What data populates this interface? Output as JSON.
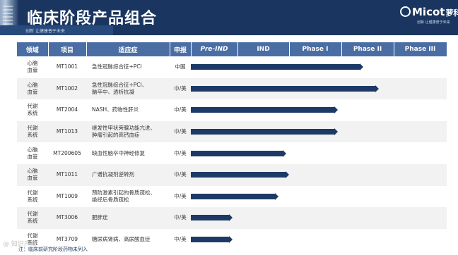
{
  "header": {
    "title": "临床阶段产品组合",
    "subtitle": "创新  让健康普于未来"
  },
  "logo": {
    "name": "Micot",
    "name_cn": "萝科奥特",
    "tagline": "创新  让健康普于未来"
  },
  "table": {
    "columns": [
      "领域",
      "项目",
      "适应症",
      "申报",
      "Pre-IND",
      "IND",
      "Phase I",
      "Phase II",
      "Phase III"
    ],
    "rows": [
      {
        "area": "心脑\n血管",
        "project": "MT1001",
        "indication": "急性冠脉综合征+PCI",
        "filing": "中国",
        "progress": 0.66
      },
      {
        "area": "心脑\n血管",
        "project": "MT1002",
        "indication": "急性冠脉综合征+PCI、\n脑卒中、透析抗凝",
        "filing": "中/美",
        "progress": 0.72
      },
      {
        "area": "代谢\n系统",
        "project": "MT2004",
        "indication": "NASH、药物性肝炎",
        "filing": "中/美",
        "progress": 0.56
      },
      {
        "area": "代谢\n系统",
        "project": "MT1013",
        "indication": "继发性甲状旁腺功能亢进、\n肿瘤引起的高钙血症",
        "filing": "中/美",
        "progress": 0.56
      },
      {
        "area": "心脑\n血管",
        "project": "MT200605",
        "indication": "缺血性脑卒中神经修复",
        "filing": "中/美",
        "progress": 0.36
      },
      {
        "area": "心脑\n血管",
        "project": "MT1011",
        "indication": "广谱抗凝剂逆转剂",
        "filing": "中/美",
        "progress": 0.37
      },
      {
        "area": "代谢\n系统",
        "project": "MT1009",
        "indication": "预防激素引起的骨质疏松、\n绝经后骨质疏松",
        "filing": "中/美",
        "progress": 0.33
      },
      {
        "area": "代谢\n系统",
        "project": "MT3006",
        "indication": "肥胖症",
        "filing": "中/美",
        "progress": 0.15
      },
      {
        "area": "代谢\n系统",
        "project": "MT3709",
        "indication": "糖尿病肾病、高尿酸血症",
        "filing": "中/美",
        "progress": 0.15
      }
    ]
  },
  "footnote": "注：临床前研究阶段药物未列入",
  "watermark": "@ 知识产权",
  "colors": {
    "header_bg": "#1a3660",
    "table_header_bg": "#4a6da3",
    "bar": "#1d3a66",
    "alt_row": "#f2f2f2"
  }
}
